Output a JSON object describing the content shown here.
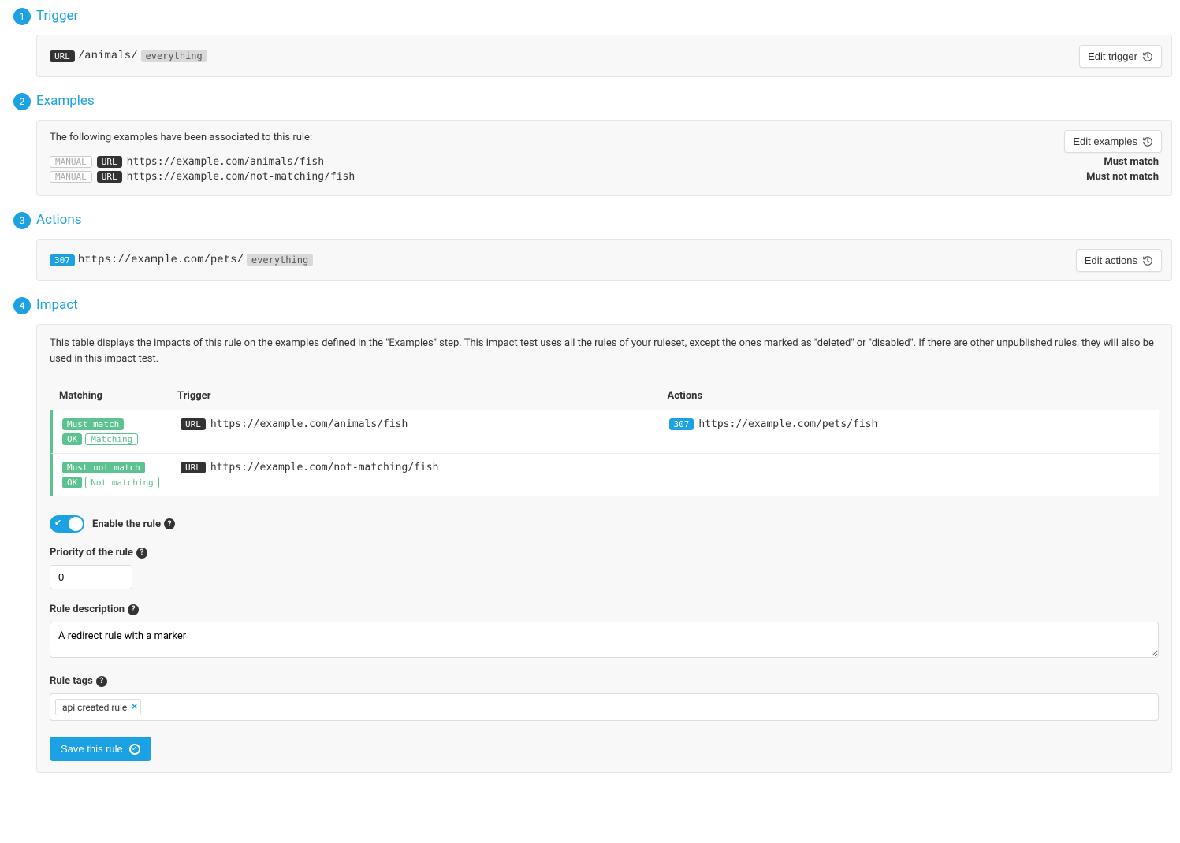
{
  "steps": {
    "trigger": {
      "num": "1",
      "title": "Trigger",
      "edit_label": "Edit trigger",
      "url_label": "URL",
      "path": "/animals/",
      "marker": "everything"
    },
    "examples": {
      "num": "2",
      "title": "Examples",
      "edit_label": "Edit examples",
      "description": "The following examples have been associated to this rule:",
      "manual_label": "MANUAL",
      "url_label": "URL",
      "rows": [
        {
          "url": "https://example.com/animals/fish",
          "result": "Must match"
        },
        {
          "url": "https://example.com/not-matching/fish",
          "result": "Must not match"
        }
      ]
    },
    "actions": {
      "num": "3",
      "title": "Actions",
      "edit_label": "Edit actions",
      "code": "307",
      "target": "https://example.com/pets/",
      "marker": "everything"
    },
    "impact": {
      "num": "4",
      "title": "Impact",
      "description": "This table displays the impacts of this rule on the examples defined in the \"Examples\" step. This impact test uses all the rules of your ruleset, except the ones marked as \"deleted\" or \"disabled\". If there are other unpublished rules, they will also be used in this impact test.",
      "table": {
        "headers": {
          "matching": "Matching",
          "trigger": "Trigger",
          "actions": "Actions"
        },
        "rows": [
          {
            "must": "Must match",
            "ok": "OK",
            "status": "Matching",
            "trigger_url": "https://example.com/animals/fish",
            "action_code": "307",
            "action_url": "https://example.com/pets/fish"
          },
          {
            "must": "Must not match",
            "ok": "OK",
            "status": "Not matching",
            "trigger_url": "https://example.com/not-matching/fish",
            "action_code": "",
            "action_url": ""
          }
        ]
      },
      "enable_label": "Enable the rule",
      "priority_label": "Priority of the rule",
      "priority_value": "0",
      "description_label": "Rule description",
      "description_value": "A redirect rule with a marker",
      "tags_label": "Rule tags",
      "tags": [
        "api created rule"
      ],
      "save_label": "Save this rule"
    }
  },
  "url_label": "URL"
}
